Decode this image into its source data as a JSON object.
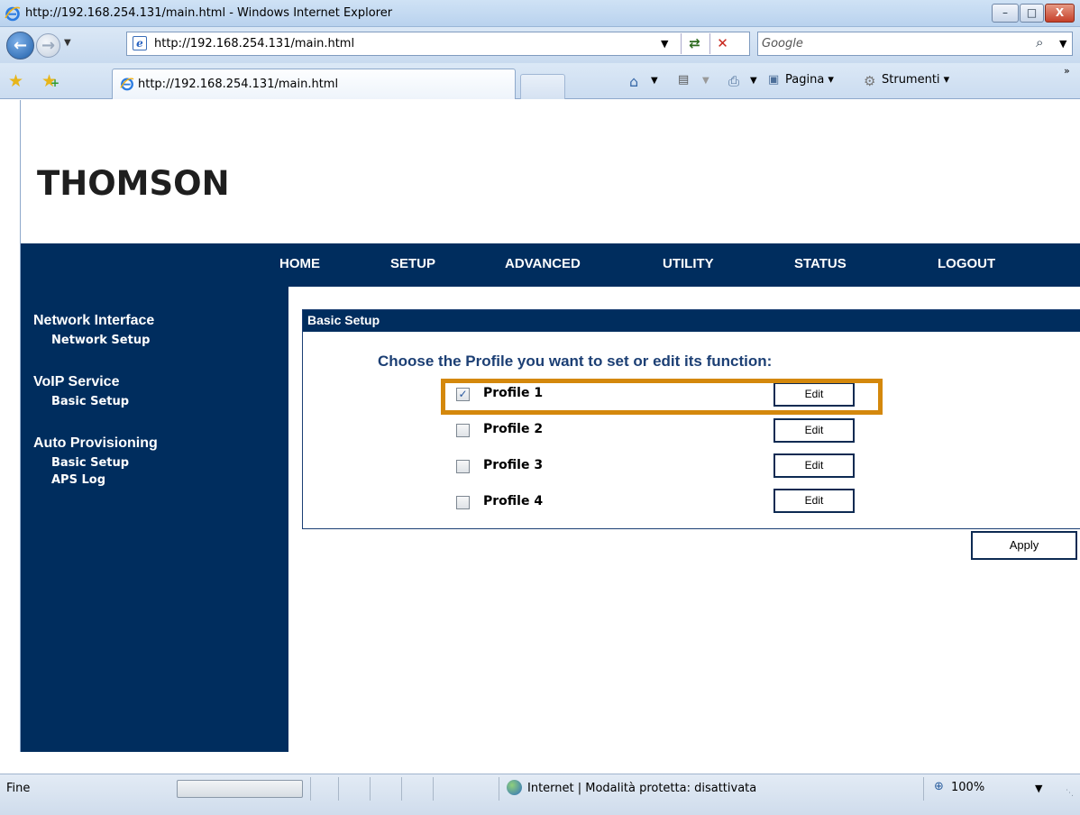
{
  "window": {
    "title": "http://192.168.254.131/main.html - Windows Internet Explorer",
    "minimize": "–",
    "maximize": "□",
    "close": "X"
  },
  "address": {
    "url": "http://192.168.254.131/main.html",
    "refresh": "⇄",
    "stop": "✕"
  },
  "search": {
    "placeholder": "Google",
    "button": "⌕"
  },
  "tab": {
    "label": "http://192.168.254.131/main.html"
  },
  "commands": {
    "page": "Pagina ▾",
    "tools": "Strumenti ▾",
    "more": "»"
  },
  "brand": {
    "logo": "THOMSON"
  },
  "topnav": [
    "HOME",
    "SETUP",
    "ADVANCED",
    "UTILITY",
    "STATUS",
    "LOGOUT"
  ],
  "sidebar": [
    {
      "heading": "Network Interface",
      "items": [
        "Network Setup"
      ]
    },
    {
      "heading": "VoIP Service",
      "items": [
        "Basic Setup"
      ]
    },
    {
      "heading": "Auto Provisioning",
      "items": [
        "Basic Setup",
        "APS Log"
      ]
    }
  ],
  "panel": {
    "title": "Basic Setup",
    "prompt": "Choose the Profile you want to set or edit its function:",
    "profiles": [
      {
        "label": "Profile 1",
        "checked": true,
        "edit": "Edit"
      },
      {
        "label": "Profile 2",
        "checked": false,
        "edit": "Edit"
      },
      {
        "label": "Profile 3",
        "checked": false,
        "edit": "Edit"
      },
      {
        "label": "Profile 4",
        "checked": false,
        "edit": "Edit"
      }
    ],
    "apply": "Apply"
  },
  "status": {
    "text": "Fine",
    "zone": "Internet | Modalità protetta: disattivata",
    "zoom": "100%"
  },
  "icons": [
    "ie-logo-icon",
    "back-arrow-icon",
    "forward-arrow-icon",
    "page-icon",
    "refresh-icon",
    "stop-icon",
    "search-icon",
    "favorites-star-icon",
    "add-favorites-icon",
    "home-icon",
    "feeds-icon",
    "print-icon",
    "page-menu-icon",
    "tools-gear-icon",
    "globe-icon",
    "zoom-icon"
  ],
  "colors": {
    "navy": "#002d5e",
    "highlight": "#d4880c",
    "prompt": "#1c3f74"
  }
}
